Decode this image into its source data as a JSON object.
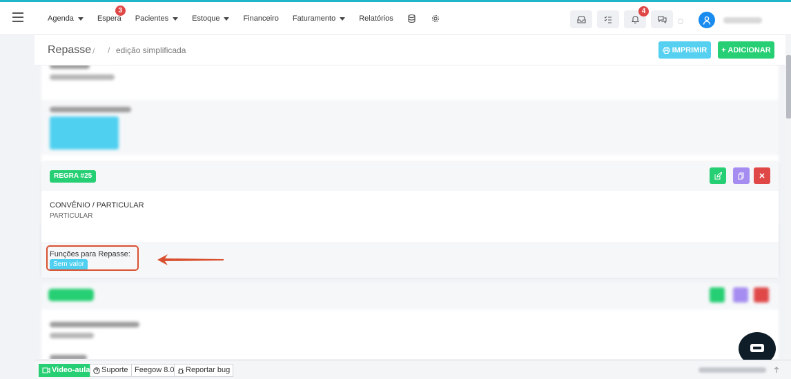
{
  "nav": {
    "items": [
      {
        "label": "Agenda",
        "caret": true
      },
      {
        "label": "Espera",
        "caret": false,
        "badge": "3"
      },
      {
        "label": "Pacientes",
        "caret": true
      },
      {
        "label": "Estoque",
        "caret": true
      },
      {
        "label": "Financeiro",
        "caret": false
      },
      {
        "label": "Faturamento",
        "caret": true
      },
      {
        "label": "Relatórios",
        "caret": false
      }
    ],
    "icons": [
      "database-icon",
      "gear-icon"
    ],
    "notifications_badge": "4"
  },
  "header": {
    "title": "Repasse",
    "separator": "/",
    "subtitle": "edição simplificada",
    "print_label": "IMPRIMIR",
    "add_label": "+ ADICIONAR"
  },
  "rule": {
    "badge": "REGRA #25",
    "field_label": "CONVÊNIO / PARTICULAR",
    "field_value": "PARTICULAR",
    "functions_label": "Funções para Repasse:",
    "functions_value": "Sem valor"
  },
  "footer": {
    "video_label": "Video-aula",
    "support_label": "Suporte",
    "version_label": "Feegow 8.0",
    "bug_label": "Reportar bug"
  },
  "colors": {
    "accent_green": "#26cf73",
    "accent_cyan": "#56d0f0",
    "accent_purple": "#a58cf0",
    "danger_red": "#e04848",
    "annotation": "#d9502f"
  }
}
